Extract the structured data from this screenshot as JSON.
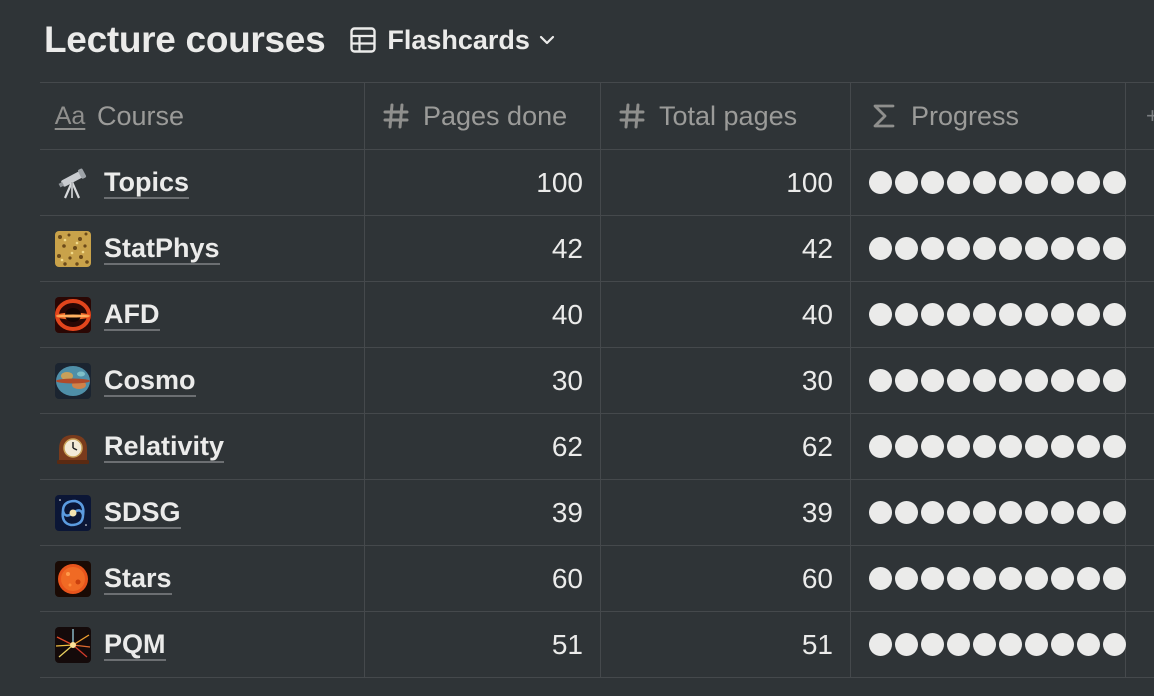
{
  "header": {
    "title": "Lecture courses",
    "view_label": "Flashcards"
  },
  "columns": [
    {
      "label": "Course",
      "icon": "text-property-icon"
    },
    {
      "label": "Pages done",
      "icon": "hash-icon"
    },
    {
      "label": "Total pages",
      "icon": "hash-icon"
    },
    {
      "label": "Progress",
      "icon": "sigma-icon"
    }
  ],
  "rows": [
    {
      "course": "Topics",
      "icon": "telescope-icon",
      "pages_done": "100",
      "total_pages": "100",
      "progress_fraction": 1.0
    },
    {
      "course": "StatPhys",
      "icon": "particles-image-icon",
      "pages_done": "42",
      "total_pages": "42",
      "progress_fraction": 1.0
    },
    {
      "course": "AFD",
      "icon": "black-hole-image-icon",
      "pages_done": "40",
      "total_pages": "40",
      "progress_fraction": 1.0
    },
    {
      "course": "Cosmo",
      "icon": "cmb-map-image-icon",
      "pages_done": "30",
      "total_pages": "30",
      "progress_fraction": 1.0
    },
    {
      "course": "Relativity",
      "icon": "mantel-clock-icon",
      "pages_done": "62",
      "total_pages": "62",
      "progress_fraction": 1.0
    },
    {
      "course": "SDSG",
      "icon": "spiral-galaxy-image-icon",
      "pages_done": "39",
      "total_pages": "39",
      "progress_fraction": 1.0
    },
    {
      "course": "Stars",
      "icon": "sun-image-icon",
      "pages_done": "60",
      "total_pages": "60",
      "progress_fraction": 1.0
    },
    {
      "course": "PQM",
      "icon": "particle-collision-image-icon",
      "pages_done": "51",
      "total_pages": "51",
      "progress_fraction": 1.0
    }
  ],
  "progress_dots_total": 10,
  "colors": {
    "background": "#2f3437",
    "text": "#ebebea",
    "muted": "#9b9b99",
    "border": "#45494c",
    "dot": "#ebebea"
  }
}
